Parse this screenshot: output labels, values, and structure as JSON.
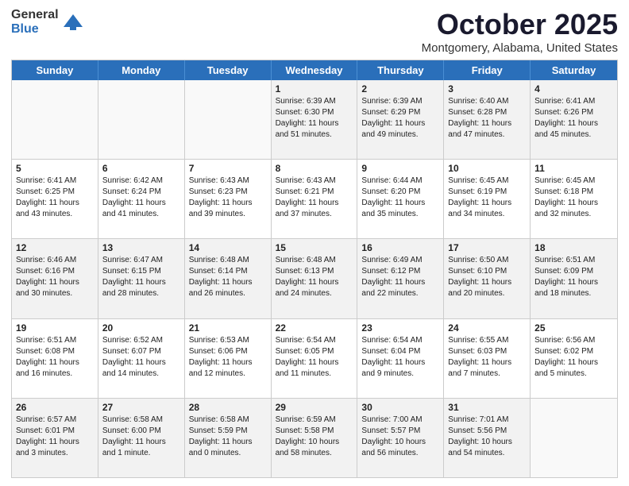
{
  "logo": {
    "general": "General",
    "blue": "Blue"
  },
  "title": {
    "month": "October 2025",
    "location": "Montgomery, Alabama, United States"
  },
  "header": {
    "days": [
      "Sunday",
      "Monday",
      "Tuesday",
      "Wednesday",
      "Thursday",
      "Friday",
      "Saturday"
    ]
  },
  "weeks": [
    [
      {
        "num": "",
        "lines": [],
        "empty": true
      },
      {
        "num": "",
        "lines": [],
        "empty": true
      },
      {
        "num": "",
        "lines": [],
        "empty": true
      },
      {
        "num": "1",
        "lines": [
          "Sunrise: 6:39 AM",
          "Sunset: 6:30 PM",
          "Daylight: 11 hours",
          "and 51 minutes."
        ]
      },
      {
        "num": "2",
        "lines": [
          "Sunrise: 6:39 AM",
          "Sunset: 6:29 PM",
          "Daylight: 11 hours",
          "and 49 minutes."
        ]
      },
      {
        "num": "3",
        "lines": [
          "Sunrise: 6:40 AM",
          "Sunset: 6:28 PM",
          "Daylight: 11 hours",
          "and 47 minutes."
        ]
      },
      {
        "num": "4",
        "lines": [
          "Sunrise: 6:41 AM",
          "Sunset: 6:26 PM",
          "Daylight: 11 hours",
          "and 45 minutes."
        ]
      }
    ],
    [
      {
        "num": "5",
        "lines": [
          "Sunrise: 6:41 AM",
          "Sunset: 6:25 PM",
          "Daylight: 11 hours",
          "and 43 minutes."
        ]
      },
      {
        "num": "6",
        "lines": [
          "Sunrise: 6:42 AM",
          "Sunset: 6:24 PM",
          "Daylight: 11 hours",
          "and 41 minutes."
        ]
      },
      {
        "num": "7",
        "lines": [
          "Sunrise: 6:43 AM",
          "Sunset: 6:23 PM",
          "Daylight: 11 hours",
          "and 39 minutes."
        ]
      },
      {
        "num": "8",
        "lines": [
          "Sunrise: 6:43 AM",
          "Sunset: 6:21 PM",
          "Daylight: 11 hours",
          "and 37 minutes."
        ]
      },
      {
        "num": "9",
        "lines": [
          "Sunrise: 6:44 AM",
          "Sunset: 6:20 PM",
          "Daylight: 11 hours",
          "and 35 minutes."
        ]
      },
      {
        "num": "10",
        "lines": [
          "Sunrise: 6:45 AM",
          "Sunset: 6:19 PM",
          "Daylight: 11 hours",
          "and 34 minutes."
        ]
      },
      {
        "num": "11",
        "lines": [
          "Sunrise: 6:45 AM",
          "Sunset: 6:18 PM",
          "Daylight: 11 hours",
          "and 32 minutes."
        ]
      }
    ],
    [
      {
        "num": "12",
        "lines": [
          "Sunrise: 6:46 AM",
          "Sunset: 6:16 PM",
          "Daylight: 11 hours",
          "and 30 minutes."
        ]
      },
      {
        "num": "13",
        "lines": [
          "Sunrise: 6:47 AM",
          "Sunset: 6:15 PM",
          "Daylight: 11 hours",
          "and 28 minutes."
        ]
      },
      {
        "num": "14",
        "lines": [
          "Sunrise: 6:48 AM",
          "Sunset: 6:14 PM",
          "Daylight: 11 hours",
          "and 26 minutes."
        ]
      },
      {
        "num": "15",
        "lines": [
          "Sunrise: 6:48 AM",
          "Sunset: 6:13 PM",
          "Daylight: 11 hours",
          "and 24 minutes."
        ]
      },
      {
        "num": "16",
        "lines": [
          "Sunrise: 6:49 AM",
          "Sunset: 6:12 PM",
          "Daylight: 11 hours",
          "and 22 minutes."
        ]
      },
      {
        "num": "17",
        "lines": [
          "Sunrise: 6:50 AM",
          "Sunset: 6:10 PM",
          "Daylight: 11 hours",
          "and 20 minutes."
        ]
      },
      {
        "num": "18",
        "lines": [
          "Sunrise: 6:51 AM",
          "Sunset: 6:09 PM",
          "Daylight: 11 hours",
          "and 18 minutes."
        ]
      }
    ],
    [
      {
        "num": "19",
        "lines": [
          "Sunrise: 6:51 AM",
          "Sunset: 6:08 PM",
          "Daylight: 11 hours",
          "and 16 minutes."
        ]
      },
      {
        "num": "20",
        "lines": [
          "Sunrise: 6:52 AM",
          "Sunset: 6:07 PM",
          "Daylight: 11 hours",
          "and 14 minutes."
        ]
      },
      {
        "num": "21",
        "lines": [
          "Sunrise: 6:53 AM",
          "Sunset: 6:06 PM",
          "Daylight: 11 hours",
          "and 12 minutes."
        ]
      },
      {
        "num": "22",
        "lines": [
          "Sunrise: 6:54 AM",
          "Sunset: 6:05 PM",
          "Daylight: 11 hours",
          "and 11 minutes."
        ]
      },
      {
        "num": "23",
        "lines": [
          "Sunrise: 6:54 AM",
          "Sunset: 6:04 PM",
          "Daylight: 11 hours",
          "and 9 minutes."
        ]
      },
      {
        "num": "24",
        "lines": [
          "Sunrise: 6:55 AM",
          "Sunset: 6:03 PM",
          "Daylight: 11 hours",
          "and 7 minutes."
        ]
      },
      {
        "num": "25",
        "lines": [
          "Sunrise: 6:56 AM",
          "Sunset: 6:02 PM",
          "Daylight: 11 hours",
          "and 5 minutes."
        ]
      }
    ],
    [
      {
        "num": "26",
        "lines": [
          "Sunrise: 6:57 AM",
          "Sunset: 6:01 PM",
          "Daylight: 11 hours",
          "and 3 minutes."
        ]
      },
      {
        "num": "27",
        "lines": [
          "Sunrise: 6:58 AM",
          "Sunset: 6:00 PM",
          "Daylight: 11 hours",
          "and 1 minute."
        ]
      },
      {
        "num": "28",
        "lines": [
          "Sunrise: 6:58 AM",
          "Sunset: 5:59 PM",
          "Daylight: 11 hours",
          "and 0 minutes."
        ]
      },
      {
        "num": "29",
        "lines": [
          "Sunrise: 6:59 AM",
          "Sunset: 5:58 PM",
          "Daylight: 10 hours",
          "and 58 minutes."
        ]
      },
      {
        "num": "30",
        "lines": [
          "Sunrise: 7:00 AM",
          "Sunset: 5:57 PM",
          "Daylight: 10 hours",
          "and 56 minutes."
        ]
      },
      {
        "num": "31",
        "lines": [
          "Sunrise: 7:01 AM",
          "Sunset: 5:56 PM",
          "Daylight: 10 hours",
          "and 54 minutes."
        ]
      },
      {
        "num": "",
        "lines": [],
        "empty": true
      }
    ]
  ]
}
